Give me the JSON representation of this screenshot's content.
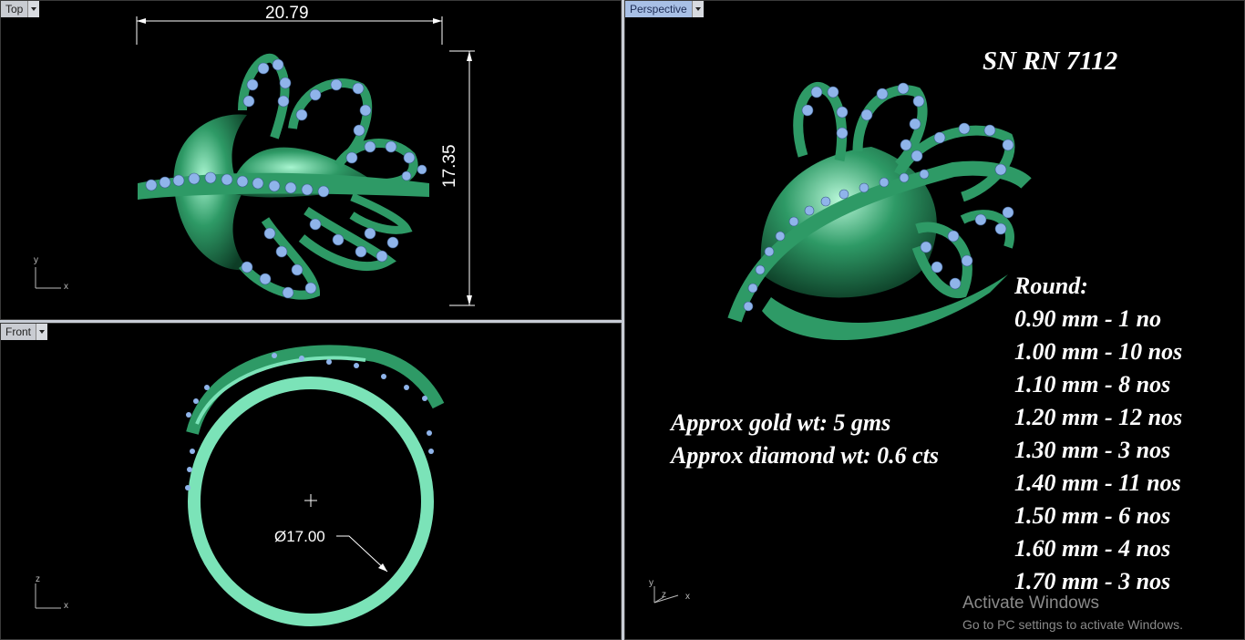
{
  "viewports": {
    "top": {
      "label": "Top",
      "dim_width": "20.79",
      "dim_height": "17.35",
      "axis_v": "y",
      "axis_h": "x"
    },
    "front": {
      "label": "Front",
      "diameter": "Ø17.00",
      "axis_v": "z",
      "axis_h": "x"
    },
    "perspective": {
      "label": "Perspective",
      "title": "SN RN 7112",
      "gold_weight": "Approx gold wt: 5 gms",
      "diamond_weight": "Approx diamond wt: 0.6 cts",
      "stones_heading": "Round:",
      "stones": [
        "0.90 mm - 1 no",
        "1.00 mm - 10 nos",
        "1.10 mm - 8 nos",
        "1.20 mm - 12 nos",
        "1.30 mm - 3 nos",
        "1.40 mm - 11 nos",
        "1.50 mm - 6 nos",
        "1.60 mm - 4 nos",
        "1.70 mm - 3 nos"
      ],
      "axis_labels": [
        "y",
        "z",
        "x"
      ]
    }
  },
  "watermark": {
    "line1": "Activate Windows",
    "line2": "Go to PC settings to activate Windows."
  },
  "colors": {
    "metal": "#2e9a66",
    "metal_light": "#7be3b8",
    "gem": "#8fb4ea",
    "active_tab": "#a8c0e6"
  }
}
